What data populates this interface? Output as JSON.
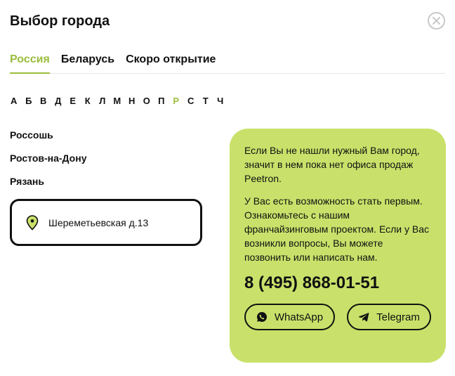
{
  "title": "Выбор города",
  "tabs": [
    {
      "label": "Россия",
      "active": true
    },
    {
      "label": "Беларусь",
      "active": false
    },
    {
      "label": "Скоро открытие",
      "active": false
    }
  ],
  "alphabet": [
    "А",
    "Б",
    "В",
    "Д",
    "Е",
    "К",
    "Л",
    "М",
    "Н",
    "О",
    "П",
    "Р",
    "С",
    "Т",
    "Ч"
  ],
  "active_letter": "Р",
  "cities": [
    "Россошь",
    "Ростов-на-Дону",
    "Рязань"
  ],
  "office": {
    "address": "Шереметьевская д.13"
  },
  "promo": {
    "text1": "Если Вы не нашли нужный Вам город, значит в нем пока нет офиса продаж Peetron.",
    "text2": "У Вас есть возможность стать первым. Ознакомьтесь с нашим франчайзинговым проектом. Если у Вас возникли вопросы, Вы можете позвонить или написать нам.",
    "phone": "8 (495) 868-01-51",
    "whatsapp_label": "WhatsApp",
    "telegram_label": "Telegram"
  },
  "colors": {
    "accent": "#9bbd3c",
    "promo_bg": "#c9e16a"
  }
}
